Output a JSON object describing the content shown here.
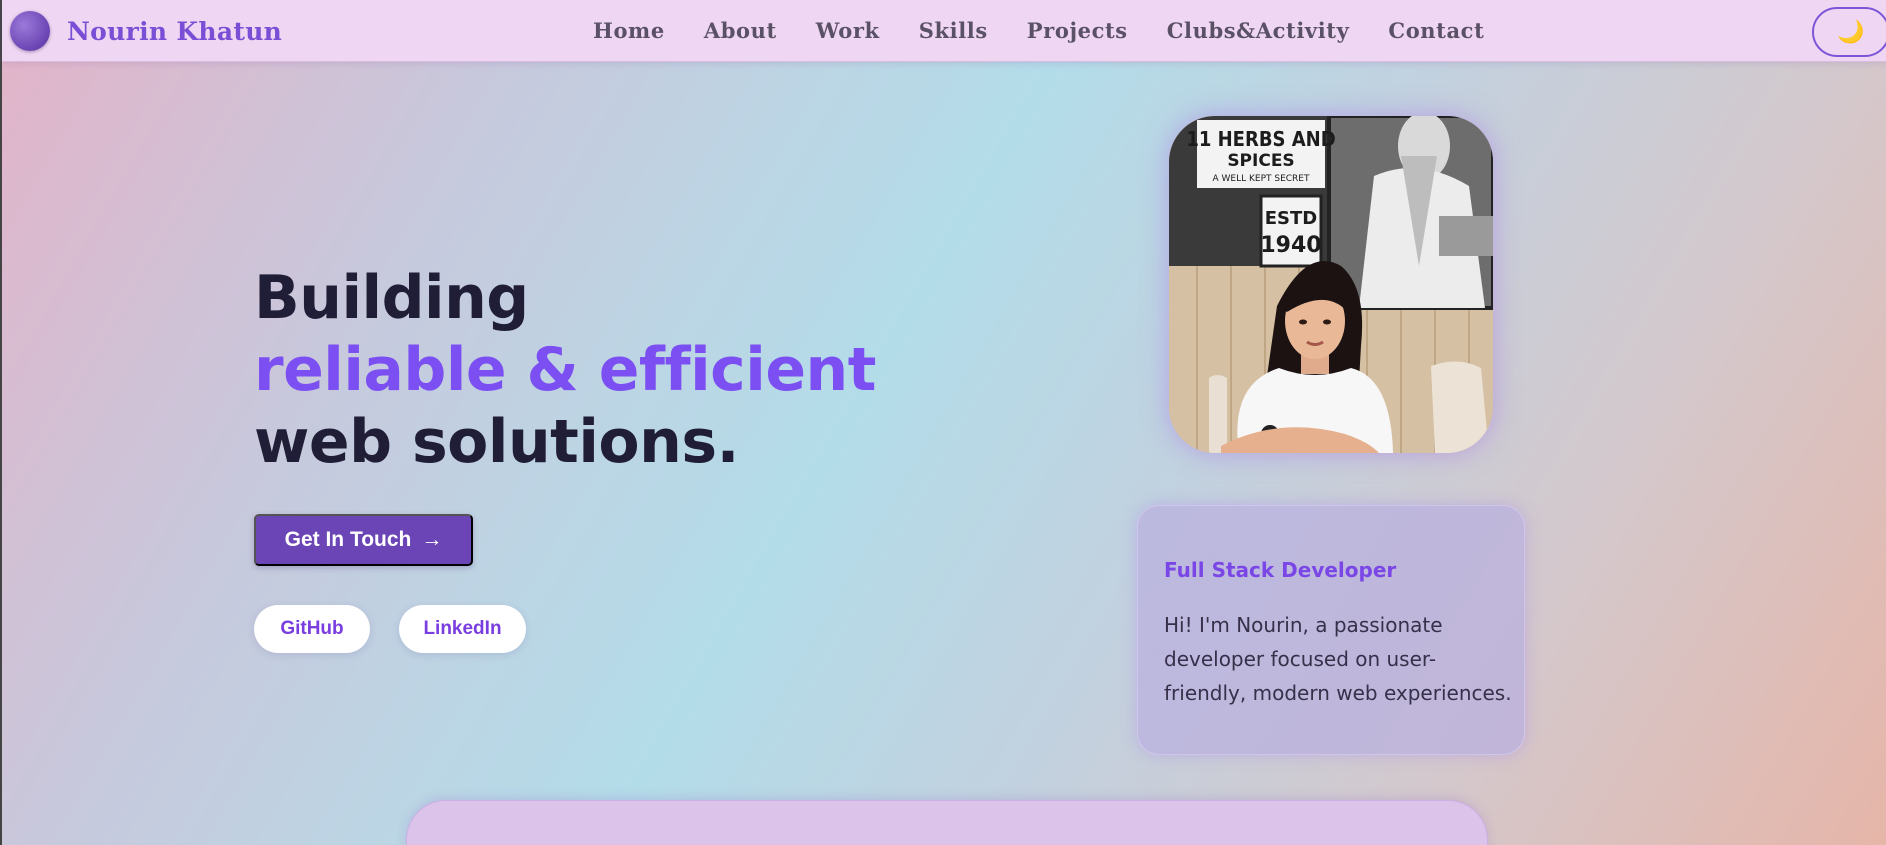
{
  "brand": {
    "name": "Nourin Khatun"
  },
  "nav": {
    "links": [
      "Home",
      "About",
      "Work",
      "Skills",
      "Projects",
      "Clubs&Activity",
      "Contact"
    ],
    "theme_toggle_icon": "🌙"
  },
  "hero": {
    "line1": "Building",
    "line2": "reliable & efficient",
    "line3": "web solutions.",
    "cta_label": "Get In Touch",
    "cta_arrow": "→",
    "social": {
      "github": "GitHub",
      "linkedin": "LinkedIn"
    }
  },
  "photo": {
    "sign_line1": "11 HERBS AND",
    "sign_line2": "SPICES",
    "sign_line3": "A WELL KEPT SECRET",
    "estd_line1": "ESTD",
    "estd_line2": "1940"
  },
  "card": {
    "title": "Full Stack Developer",
    "text": "Hi! I'm Nourin, a passionate developer focused on user-friendly, modern web experiences."
  },
  "colors": {
    "accent": "#7b4ff2",
    "cta_bg": "#6b45b6",
    "nav_bg": "#efd6f2",
    "heading": "#201d36"
  }
}
